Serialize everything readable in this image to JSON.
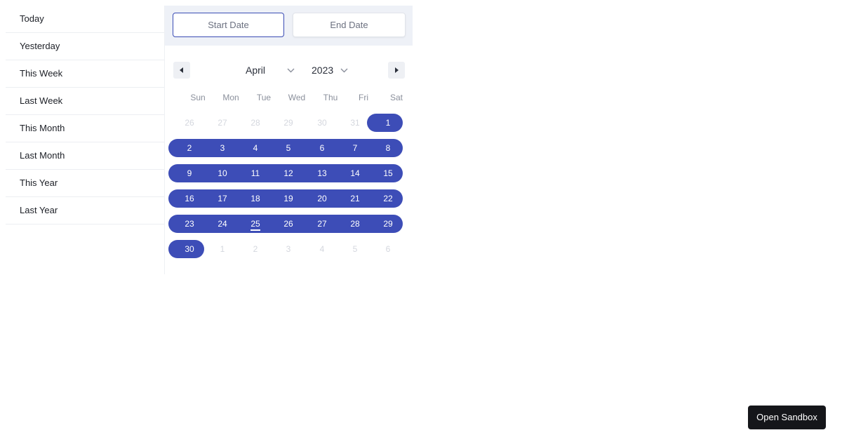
{
  "presets": [
    "Today",
    "Yesterday",
    "This Week",
    "Last Week",
    "This Month",
    "Last Month",
    "This Year",
    "Last Year"
  ],
  "inputs": {
    "start_placeholder": "Start Date",
    "end_placeholder": "End Date"
  },
  "calendar": {
    "month": "April",
    "year": "2023",
    "weekdays": [
      "Sun",
      "Mon",
      "Tue",
      "Wed",
      "Thu",
      "Fri",
      "Sat"
    ],
    "weeks": [
      [
        "26",
        "27",
        "28",
        "29",
        "30",
        "31",
        "1"
      ],
      [
        "2",
        "3",
        "4",
        "5",
        "6",
        "7",
        "8"
      ],
      [
        "9",
        "10",
        "11",
        "12",
        "13",
        "14",
        "15"
      ],
      [
        "16",
        "17",
        "18",
        "19",
        "20",
        "21",
        "22"
      ],
      [
        "23",
        "24",
        "25",
        "26",
        "27",
        "28",
        "29"
      ],
      [
        "30",
        "1",
        "2",
        "3",
        "4",
        "5",
        "6"
      ]
    ],
    "today": "25"
  },
  "footer": {
    "sandbox_label": "Open Sandbox"
  },
  "colors": {
    "accent": "#3d4db7",
    "muted": "#d4d7de",
    "panel": "#eef1f7"
  }
}
